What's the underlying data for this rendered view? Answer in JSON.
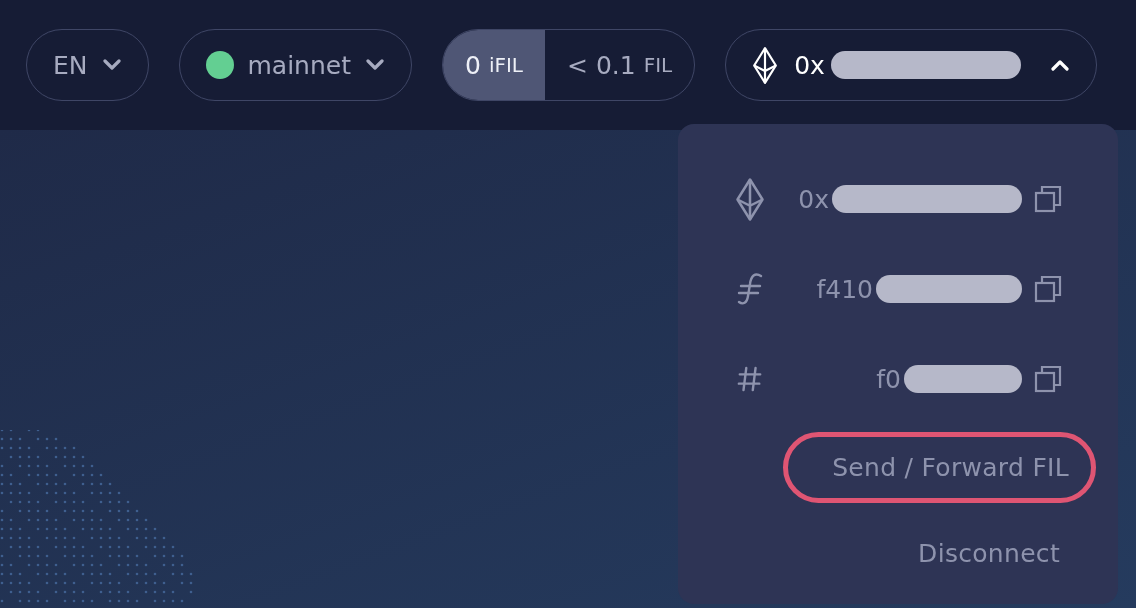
{
  "language": {
    "label": "EN",
    "expanded": false
  },
  "network": {
    "label": "mainnet",
    "color": "#63cf92",
    "expanded": false
  },
  "balances": [
    {
      "amount": "0",
      "unit": "iFIL",
      "selected": true
    },
    {
      "amount": "< 0.1",
      "unit": "FIL",
      "selected": false
    }
  ],
  "wallet": {
    "address_prefix": "0x",
    "expanded": true
  },
  "wallet_menu": {
    "addresses": [
      {
        "kind": "eth",
        "prefix": "0x"
      },
      {
        "kind": "f4",
        "prefix": "f410"
      },
      {
        "kind": "id",
        "prefix": "f0"
      }
    ],
    "actions": [
      {
        "label": "Send / Forward FIL",
        "highlighted": true
      },
      {
        "label": "Disconnect",
        "highlighted": false
      }
    ]
  }
}
